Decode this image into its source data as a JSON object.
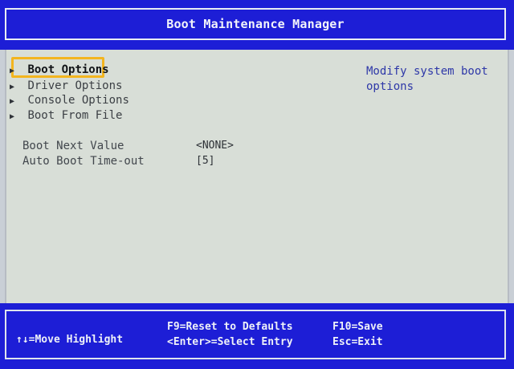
{
  "header": {
    "title": "Boot Maintenance Manager"
  },
  "menu": {
    "items": [
      {
        "label": "Boot Options",
        "selected": true
      },
      {
        "label": "Driver Options",
        "selected": false
      },
      {
        "label": "Console Options",
        "selected": false
      },
      {
        "label": "Boot From File",
        "selected": false
      }
    ],
    "arrow_glyph": "▶"
  },
  "fields": {
    "boot_next_value": {
      "label": "Boot Next Value",
      "value": "<NONE>"
    },
    "auto_boot_timeout": {
      "label": "Auto Boot Time-out",
      "value": "[5]"
    }
  },
  "help": {
    "text": "Modify system boot options"
  },
  "footer": {
    "move_highlight": "↑↓=Move Highlight",
    "reset_defaults": "F9=Reset to Defaults",
    "select_entry": "<Enter>=Select Entry",
    "save": "F10=Save",
    "exit": "Esc=Exit"
  },
  "colors": {
    "header_blue": "#1d1ed6",
    "content_bg": "#d8ded7",
    "highlight_orange": "#f3b51f",
    "help_blue": "#2e38a8"
  }
}
